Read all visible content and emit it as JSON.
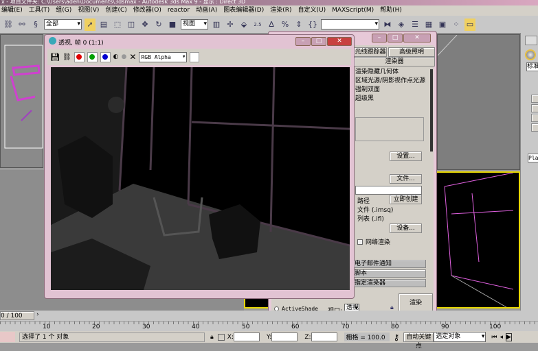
{
  "window": {
    "title": "x  - 项目文件夹: C:\\Users\\aden\\Documents\\3dsmax   - Autodesk 3ds Max 9   - 显示 : Direct 3D"
  },
  "menu": [
    "编辑(E)",
    "工具(T)",
    "组(G)",
    "视图(V)",
    "创建(C)",
    "修改器(O)",
    "reactor",
    "动画(A)",
    "图表编辑器(D)",
    "渲染(R)",
    "自定义(U)",
    "MAXScript(M)",
    "帮助(H)"
  ],
  "toolbar": {
    "selection_filter": "全部",
    "coord_system": "视图",
    "snap_25": "2.5",
    "named_selection": ""
  },
  "render_frame": {
    "title": "透视, 帧 0 (1:1)",
    "channel": "RGB Alpha",
    "colors": {
      "red": "#e00000",
      "green": "#00a000",
      "blue": "#0000d0"
    }
  },
  "render_setup": {
    "tabs": [
      "光线跟踪器",
      "高级照明",
      "渲染器"
    ],
    "options": [
      "渲染隐藏几何体",
      "区域光源/阴影视作点光源",
      "强制双面",
      "超级黑"
    ],
    "setup_button": "设置...",
    "files_button": "文件...",
    "path_label": "路径",
    "create_now_button": "立即创建",
    "imsq_label": "文件 (.imsq)",
    "ifl_label": "列表 (.ifl)",
    "devices_button": "设备...",
    "net_render": "网络渲染",
    "rollouts": [
      "电子邮件通知",
      "脚本",
      "指定渲染器"
    ],
    "activeshade": "ActiveShade",
    "viewport_label": "视口:",
    "viewport_value": "透视",
    "render_button": "渲染"
  },
  "command_panel": {
    "dropdown": "标准",
    "name_field": "Plane"
  },
  "timeline": {
    "frame": "0 / 100",
    "ticks": [
      "10",
      "20",
      "30",
      "40",
      "50",
      "60",
      "70",
      "80",
      "90",
      "100"
    ]
  },
  "status": {
    "message": "选择了 1 个 对象",
    "x_label": "X:",
    "y_label": "Y:",
    "z_label": "Z:",
    "grid": "栅格 = 100.0",
    "auto_key": "自动关键点",
    "key_filter": "选定对象"
  }
}
